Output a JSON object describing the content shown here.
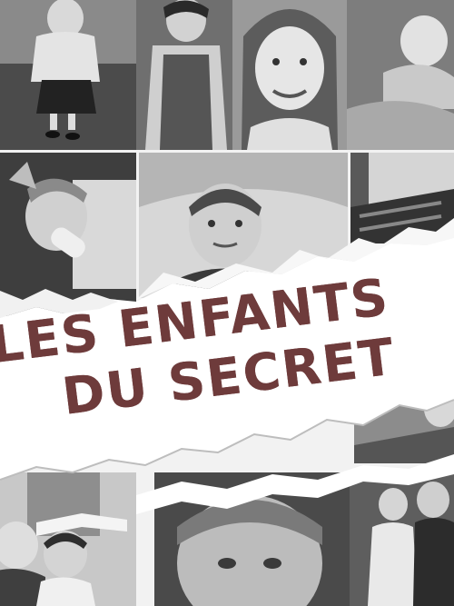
{
  "poster": {
    "title_line_1": "LES ENFANTS",
    "title_line_2": "DU SECRET",
    "title_color": "#6e3b3b"
  }
}
